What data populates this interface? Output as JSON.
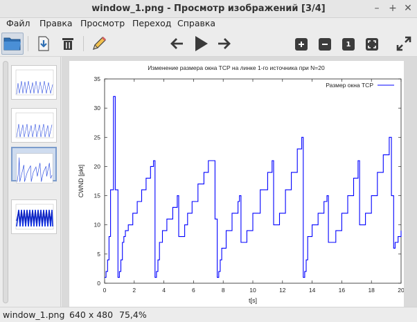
{
  "window": {
    "title": "window_1.png - Просмотр изображений [3/4]",
    "minimize_glyph": "–",
    "maximize_glyph": "+",
    "close_glyph": "✕"
  },
  "menu": {
    "items": [
      "Файл",
      "Правка",
      "Просмотр",
      "Переход",
      "Справка"
    ]
  },
  "toolbar": {
    "icons": [
      "folder-icon",
      "save-icon",
      "trash-icon",
      "pencil-icon",
      "back-arrow-icon",
      "play-icon",
      "forward-arrow-icon",
      "zoom-in-icon",
      "zoom-out-icon",
      "zoom-100-icon",
      "zoom-fit-icon",
      "fullscreen-icon"
    ],
    "zoom_100_label": "1"
  },
  "sidebar": {
    "thumbnail_count": 4,
    "selected_index": 2
  },
  "status": {
    "filename": "window_1.png",
    "dimensions": "640 x 480",
    "zoom": "75,4%"
  },
  "chart_data": {
    "type": "line",
    "title": "Изменение размера окна TCP на линке 1-го источника при N=20",
    "xlabel": "t[s]",
    "ylabel": "CWND [pkt]",
    "xlim": [
      0,
      20
    ],
    "ylim": [
      0,
      35
    ],
    "xticks": [
      0,
      2,
      4,
      6,
      8,
      10,
      12,
      14,
      16,
      18,
      20
    ],
    "yticks": [
      0,
      5,
      10,
      15,
      20,
      25,
      30,
      35
    ],
    "legend": "top-right",
    "series": [
      {
        "name": "Размер окна TCP",
        "color": "#0000ff",
        "points": [
          [
            0.0,
            1
          ],
          [
            0.1,
            2
          ],
          [
            0.2,
            4
          ],
          [
            0.3,
            8
          ],
          [
            0.4,
            16
          ],
          [
            0.55,
            16
          ],
          [
            0.6,
            32
          ],
          [
            0.7,
            32
          ],
          [
            0.72,
            16
          ],
          [
            0.85,
            16
          ],
          [
            0.9,
            1
          ],
          [
            1.0,
            2
          ],
          [
            1.1,
            4
          ],
          [
            1.2,
            7
          ],
          [
            1.3,
            8
          ],
          [
            1.4,
            9
          ],
          [
            1.6,
            10
          ],
          [
            1.9,
            12
          ],
          [
            2.2,
            14
          ],
          [
            2.5,
            16
          ],
          [
            2.8,
            18
          ],
          [
            3.1,
            20
          ],
          [
            3.3,
            21
          ],
          [
            3.35,
            21
          ],
          [
            3.4,
            1
          ],
          [
            3.5,
            2
          ],
          [
            3.6,
            4
          ],
          [
            3.7,
            7
          ],
          [
            3.9,
            9
          ],
          [
            4.2,
            11
          ],
          [
            4.6,
            13
          ],
          [
            4.9,
            15
          ],
          [
            4.95,
            15
          ],
          [
            5.0,
            8
          ],
          [
            5.2,
            8
          ],
          [
            5.4,
            10
          ],
          [
            5.6,
            12
          ],
          [
            5.9,
            14
          ],
          [
            6.3,
            17
          ],
          [
            6.7,
            19
          ],
          [
            7.0,
            21
          ],
          [
            7.4,
            21
          ],
          [
            7.45,
            11
          ],
          [
            7.55,
            11
          ],
          [
            7.6,
            1
          ],
          [
            7.7,
            2
          ],
          [
            7.8,
            4
          ],
          [
            7.9,
            6
          ],
          [
            8.2,
            9
          ],
          [
            8.6,
            12
          ],
          [
            9.0,
            14
          ],
          [
            9.1,
            15
          ],
          [
            9.15,
            15
          ],
          [
            9.2,
            7
          ],
          [
            9.4,
            7
          ],
          [
            9.6,
            9
          ],
          [
            10.0,
            12
          ],
          [
            10.5,
            16
          ],
          [
            11.0,
            19
          ],
          [
            11.3,
            21
          ],
          [
            11.35,
            21
          ],
          [
            11.4,
            10
          ],
          [
            11.6,
            10
          ],
          [
            11.8,
            12
          ],
          [
            12.2,
            16
          ],
          [
            12.6,
            19
          ],
          [
            13.0,
            23
          ],
          [
            13.3,
            25
          ],
          [
            13.35,
            25
          ],
          [
            13.4,
            1
          ],
          [
            13.5,
            2
          ],
          [
            13.6,
            4
          ],
          [
            13.7,
            8
          ],
          [
            14.0,
            10
          ],
          [
            14.4,
            12
          ],
          [
            14.8,
            14
          ],
          [
            15.0,
            15
          ],
          [
            15.05,
            15
          ],
          [
            15.1,
            7
          ],
          [
            15.3,
            7
          ],
          [
            15.6,
            9
          ],
          [
            16.0,
            12
          ],
          [
            16.4,
            15
          ],
          [
            16.8,
            18
          ],
          [
            17.1,
            21
          ],
          [
            17.15,
            21
          ],
          [
            17.2,
            10
          ],
          [
            17.4,
            10
          ],
          [
            17.6,
            12
          ],
          [
            18.0,
            15
          ],
          [
            18.4,
            19
          ],
          [
            18.8,
            22
          ],
          [
            19.2,
            25
          ],
          [
            19.3,
            25
          ],
          [
            19.35,
            15
          ],
          [
            19.45,
            15
          ],
          [
            19.5,
            6
          ],
          [
            19.6,
            7
          ],
          [
            19.8,
            8
          ],
          [
            20.0,
            9
          ]
        ]
      }
    ]
  }
}
